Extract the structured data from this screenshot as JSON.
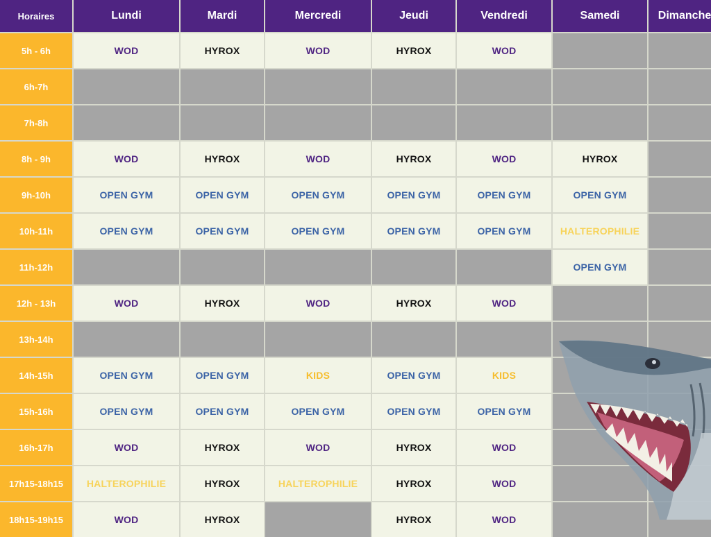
{
  "header": {
    "time_col": "Horaires",
    "days": [
      "Lundi",
      "Mardi",
      "Mercredi",
      "Jeudi",
      "Vendredi",
      "Samedi",
      "Dimanche"
    ]
  },
  "rows": [
    {
      "time": "5h - 6h",
      "cells": [
        "WOD",
        "HYROX",
        "WOD",
        "HYROX",
        "WOD",
        "",
        ""
      ]
    },
    {
      "time": "6h-7h",
      "cells": [
        "",
        "",
        "",
        "",
        "",
        "",
        ""
      ]
    },
    {
      "time": "7h-8h",
      "cells": [
        "",
        "",
        "",
        "",
        "",
        "",
        ""
      ]
    },
    {
      "time": "8h - 9h",
      "cells": [
        "WOD",
        "HYROX",
        "WOD",
        "HYROX",
        "WOD",
        "HYROX",
        ""
      ]
    },
    {
      "time": "9h-10h",
      "cells": [
        "OPEN GYM",
        "OPEN GYM",
        "OPEN GYM",
        "OPEN GYM",
        "OPEN GYM",
        "OPEN GYM",
        ""
      ]
    },
    {
      "time": "10h-11h",
      "cells": [
        "OPEN GYM",
        "OPEN GYM",
        "OPEN GYM",
        "OPEN GYM",
        "OPEN GYM",
        "HALTEROPHILIE",
        ""
      ]
    },
    {
      "time": "11h-12h",
      "cells": [
        "",
        "",
        "",
        "",
        "",
        "OPEN GYM",
        ""
      ]
    },
    {
      "time": "12h - 13h",
      "cells": [
        "WOD",
        "HYROX",
        "WOD",
        "HYROX",
        "WOD",
        "",
        ""
      ]
    },
    {
      "time": "13h-14h",
      "cells": [
        "",
        "",
        "",
        "",
        "",
        "",
        ""
      ]
    },
    {
      "time": "14h-15h",
      "cells": [
        "OPEN GYM",
        "OPEN GYM",
        "KIDS",
        "OPEN GYM",
        "KIDS",
        "",
        ""
      ]
    },
    {
      "time": "15h-16h",
      "cells": [
        "OPEN GYM",
        "OPEN GYM",
        "OPEN GYM",
        "OPEN GYM",
        "OPEN GYM",
        "",
        ""
      ]
    },
    {
      "time": "16h-17h",
      "cells": [
        "WOD",
        "HYROX",
        "WOD",
        "HYROX",
        "WOD",
        "",
        ""
      ]
    },
    {
      "time": "17h15-18h15",
      "cells": [
        "HALTEROPHILIE",
        "HYROX",
        "HALTEROPHILIE",
        "HYROX",
        "WOD",
        "",
        ""
      ]
    },
    {
      "time": "18h15-19h15",
      "cells": [
        "WOD",
        "HYROX",
        "",
        "HYROX",
        "WOD",
        "",
        ""
      ]
    }
  ],
  "colors": {
    "header_bg": "#4f2482",
    "time_bg": "#fbb72c",
    "slot_bg": "#f2f4e6",
    "empty_bg": "#a5a5a5",
    "wod": "#4f2482",
    "hyrox": "#111111",
    "open_gym": "#3b63a6",
    "kids": "#f6bd2c",
    "halterophilie": "#f7d35a"
  },
  "decor": {
    "image": "shark-illustration"
  }
}
